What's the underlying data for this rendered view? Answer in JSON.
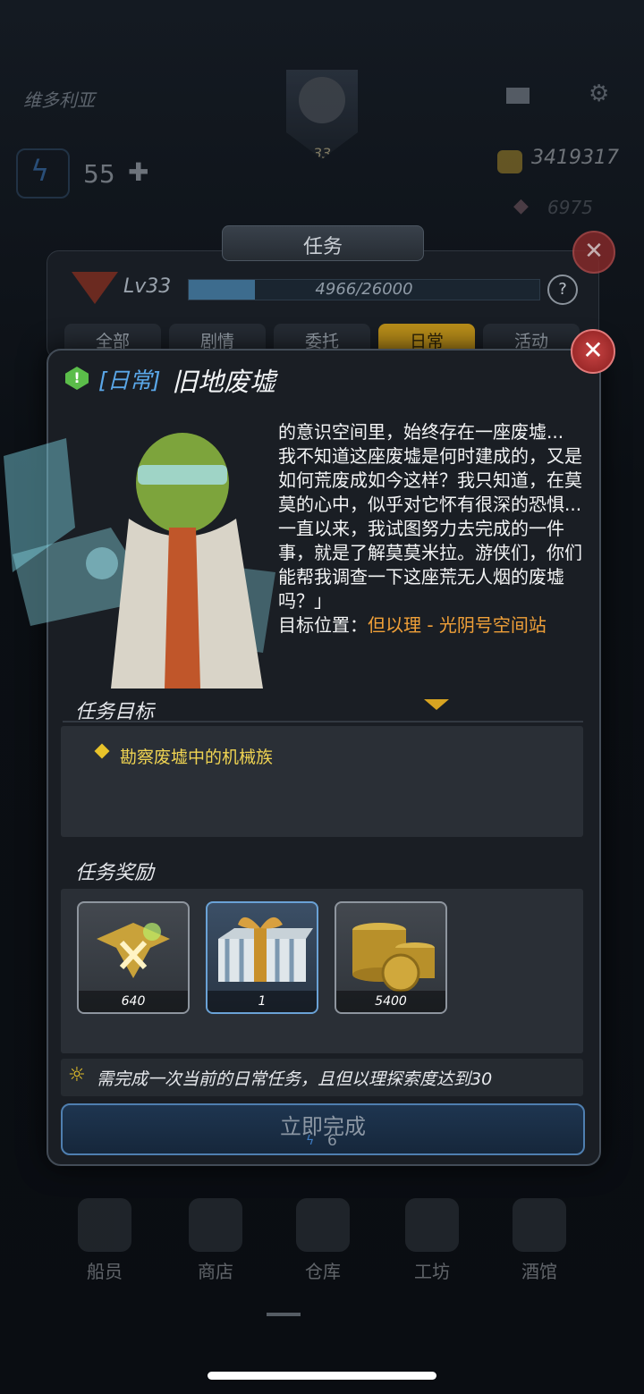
{
  "hud": {
    "player_name": "维多利亚",
    "player_level": "33",
    "energy": "55",
    "coins": "3419317",
    "gems": "6975"
  },
  "quest_list": {
    "title": "任务",
    "level_label": "Lv33",
    "exp_text": "4966/26000",
    "exp_fraction": 0.19,
    "tabs": [
      "全部",
      "剧情",
      "委托",
      "日常",
      "活动"
    ],
    "active_tab": "日常"
  },
  "quest": {
    "type_label": "[日常]",
    "title": "旧地废墟",
    "story_lines": [
      "的意识空间里，始终存在一座废墟...",
      "我不知道这座废墟是何时建成的，又是如何荒废成如今这样？我只知道，在莫莫的心中，似乎对它怀有很深的恐惧...",
      "一直以来，我试图努力去完成的一件事，就是了解莫莫米拉。游侠们，你们能帮我调查一下这座荒无人烟的废墟吗？」"
    ],
    "location_label": "目标位置：",
    "location_value": "但以理 - 光阴号空间站",
    "objectives_header": "任务目标",
    "objective": "勘察废墟中的机械族",
    "rewards_header": "任务奖励",
    "rewards": [
      {
        "icon": "exp-badge-icon",
        "count": "640"
      },
      {
        "icon": "gift-box-icon",
        "count": "1"
      },
      {
        "icon": "gold-coins-icon",
        "count": "5400"
      }
    ],
    "hint": "需完成一次当前的日常任务，且但以理探索度达到30",
    "complete_label": "立即完成",
    "complete_cost": "6"
  },
  "bottom_nav": [
    "船员",
    "商店",
    "仓库",
    "工坊",
    "酒馆"
  ],
  "colors": {
    "accent_gold": "#d8a421",
    "location_orange": "#f0a038",
    "objective_yellow": "#f0d452",
    "type_blue": "#5aa7e8",
    "close_red": "#c84343"
  }
}
